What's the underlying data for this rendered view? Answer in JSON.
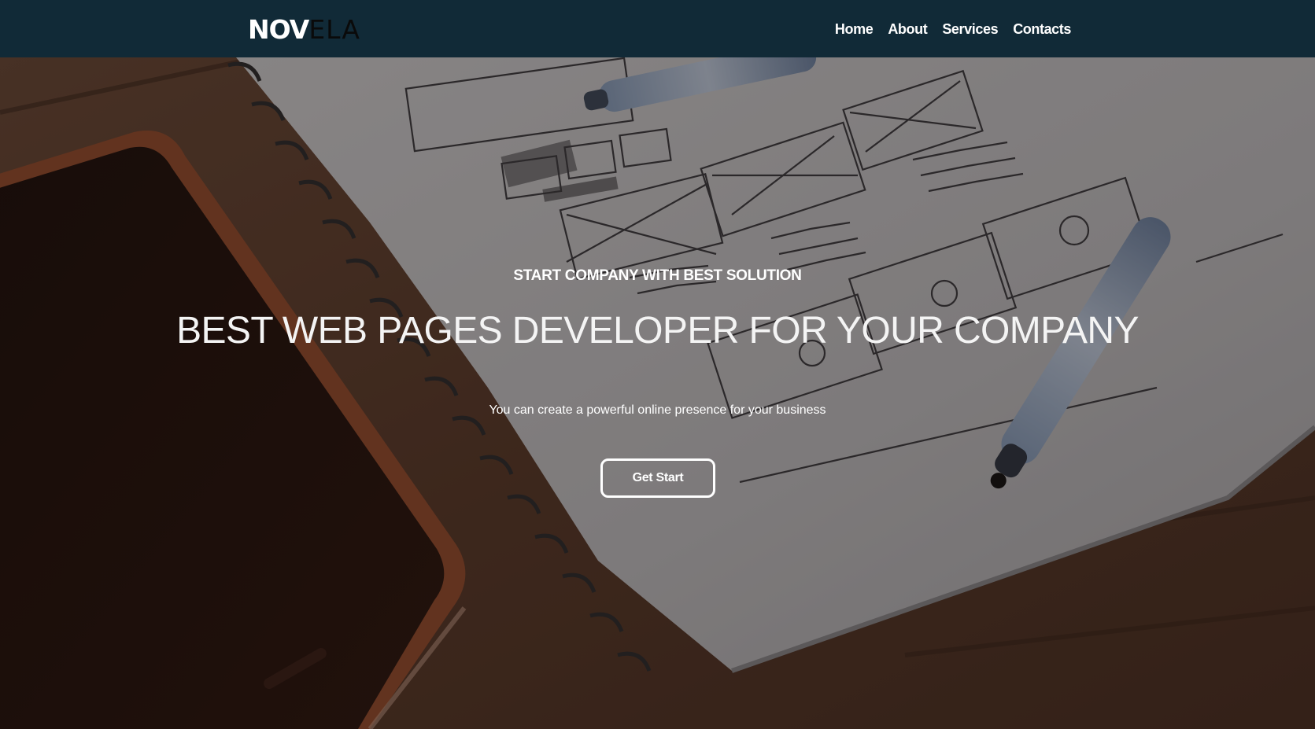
{
  "navbar": {
    "logo_part1": "NOV",
    "logo_part2": "ELA",
    "links": [
      {
        "label": "Home"
      },
      {
        "label": "About"
      },
      {
        "label": "Services"
      },
      {
        "label": "Contacts"
      }
    ]
  },
  "hero": {
    "eyebrow": "START COMPANY WITH BEST SOLUTION",
    "headline": "BEST WEB PAGES DEVELOPER FOR YOUR COMPANY",
    "subtitle": "You can create a powerful online presence for your business",
    "cta_label": "Get Start",
    "background_image": "desk-with-smartphone-and-wireframe-sketch-notebook"
  },
  "colors": {
    "navbar_bg": "#112a37",
    "text": "#ffffff",
    "logo_accent": "#0a0a0a"
  }
}
